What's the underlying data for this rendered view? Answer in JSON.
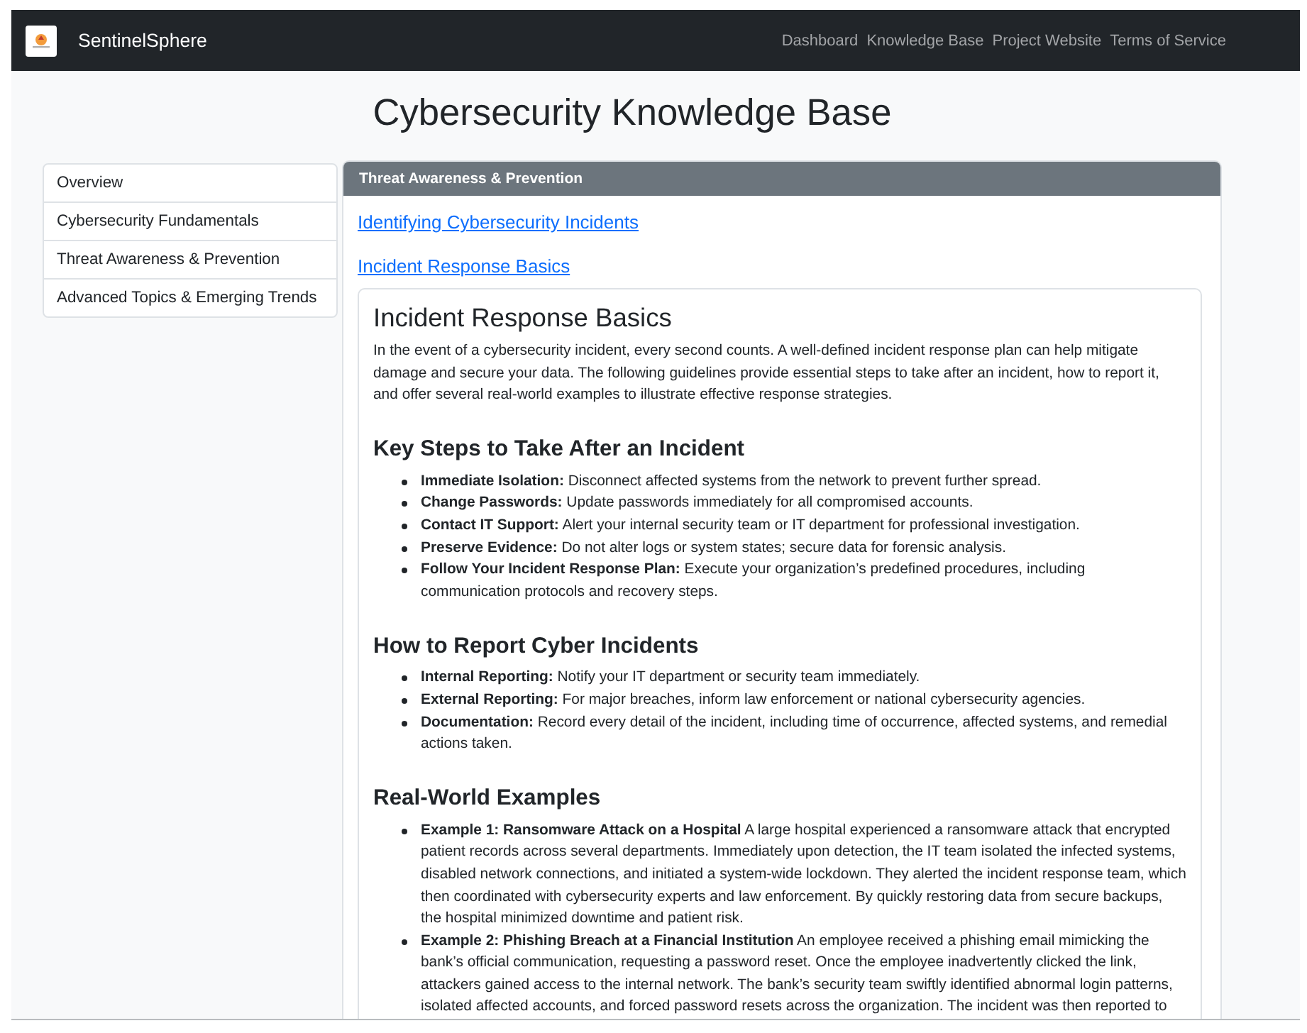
{
  "navbar": {
    "brand": "SentinelSphere",
    "links": [
      "Dashboard",
      "Knowledge Base",
      "Project Website",
      "Terms of Service"
    ]
  },
  "page_title": "Cybersecurity Knowledge Base",
  "sidebar": {
    "items": [
      {
        "label": "Overview",
        "selected": false
      },
      {
        "label": "Cybersecurity Fundamentals",
        "selected": false
      },
      {
        "label": "Threat Awareness & Prevention",
        "selected": false
      },
      {
        "label": "Advanced Topics & Emerging Trends",
        "selected": false
      }
    ]
  },
  "section": {
    "header": "Threat Awareness & Prevention",
    "links": [
      "Identifying Cybersecurity Incidents",
      "Incident Response Basics"
    ],
    "article": {
      "title": "Incident Response Basics",
      "intro": "In the event of a cybersecurity incident, every second counts. A well-defined incident response plan can help mitigate damage and secure your data. The following guidelines provide essential steps to take after an incident, how to report it, and offer several real-world examples to illustrate effective response strategies.",
      "sections": [
        {
          "heading": "Key Steps to Take After an Incident",
          "items": [
            "**Immediate Isolation:** Disconnect affected systems from the network to prevent further spread.",
            "**Change Passwords:** Update passwords immediately for all compromised accounts.",
            "**Contact IT Support:** Alert your internal security team or IT department for professional investigation.",
            "**Preserve Evidence:** Do not alter logs or system states; secure data for forensic analysis.",
            "**Follow Your Incident Response Plan:** Execute your organization’s predefined procedures, including communication protocols and recovery steps."
          ]
        },
        {
          "heading": "How to Report Cyber Incidents",
          "items": [
            "**Internal Reporting:** Notify your IT department or security team immediately.",
            "**External Reporting:** For major breaches, inform law enforcement or national cybersecurity agencies.",
            "**Documentation:** Record every detail of the incident, including time of occurrence, affected systems, and remedial actions taken."
          ]
        },
        {
          "heading": "Real-World Examples",
          "items": [
            "**Example 1: Ransomware Attack on a Hospital** A large hospital experienced a ransomware attack that encrypted patient records across several departments. Immediately upon detection, the IT team isolated the infected systems, disabled network connections, and initiated a system-wide lockdown. They alerted the incident response team, which then coordinated with cybersecurity experts and law enforcement. By quickly restoring data from secure backups, the hospital minimized downtime and patient risk.",
            "**Example 2: Phishing Breach at a Financial Institution** An employee received a phishing email mimicking the bank’s official communication, requesting a password reset. Once the employee inadvertently clicked the link, attackers gained access to the internal network. The bank’s security team swiftly identified abnormal login patterns, isolated affected accounts, and forced password resets across the organization. The incident was then reported to"
          ]
        }
      ]
    }
  }
}
